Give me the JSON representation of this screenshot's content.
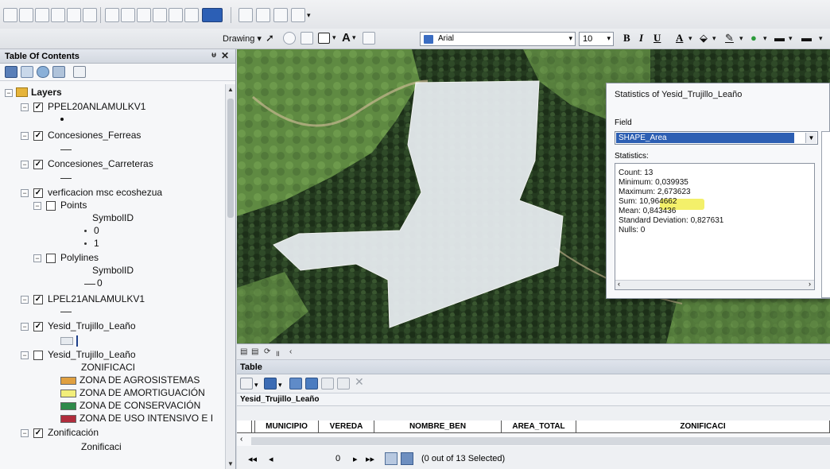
{
  "toolbar": {
    "drawing_label": "Drawing",
    "font_name": "Arial",
    "font_size": "10",
    "bold": "B",
    "italic": "I",
    "underline": "U",
    "font_color": "A"
  },
  "toc": {
    "title": "Table Of Contents",
    "pin": "ᵾ",
    "close": "✕",
    "root_label": "Layers",
    "layers": [
      {
        "label": "PPEL20ANLAMULKV1",
        "checked": true
      },
      {
        "label": "Concesiones_Ferreas",
        "checked": true
      },
      {
        "label": "Concesiones_Carreteras",
        "checked": true
      },
      {
        "label": "verficacion msc ecoshezua",
        "checked": true
      },
      {
        "label": "Points",
        "checked": false
      },
      {
        "label": "SymbolID",
        "checked": null
      },
      {
        "label": "0",
        "checked": null
      },
      {
        "label": "1",
        "checked": null
      },
      {
        "label": "Polylines",
        "checked": false
      },
      {
        "label": "SymbolID",
        "checked": null
      },
      {
        "label": "0",
        "checked": null
      },
      {
        "label": "LPEL21ANLAMULKV1",
        "checked": true
      },
      {
        "label": "Yesid_Trujillo_Leaño",
        "checked": true
      },
      {
        "label": "Yesid_Trujillo_Leaño",
        "checked": false
      },
      {
        "label": "ZONIFICACI",
        "checked": null
      },
      {
        "label": "Zonificación",
        "checked": true
      },
      {
        "label": "Zonificaci",
        "checked": null
      }
    ],
    "legend": [
      {
        "label": "ZONA DE AGROSISTEMAS",
        "color": "#e0a040"
      },
      {
        "label": "ZONA DE AMORTIGUACIÓN",
        "color": "#f2ee7a"
      },
      {
        "label": "ZONA DE CONSERVACIÓN",
        "color": "#2e8a4a"
      },
      {
        "label": "ZONA DE USO INTENSIVO E I",
        "color": "#b02c3c"
      }
    ]
  },
  "stats": {
    "title": "Statistics of Yesid_Trujillo_Leaño",
    "field_label": "Field",
    "field_value": "SHAPE_Area",
    "statistics_label": "Statistics:",
    "lines": [
      "Count:    13",
      "Minimum:  0,039935",
      "Maximum:  2,673623",
      "Sum:         10,964662",
      "Mean:       0,843436",
      "Standard Deviation: 0,827631",
      "Nulls:      0"
    ]
  },
  "table": {
    "title": "Table",
    "layer_name": "Yesid_Trujillo_Leaño",
    "columns": [
      "MUNICIPIO",
      "VEREDA",
      "NOMBRE_BEN",
      "AREA_TOTAL",
      "ZONIFICACI"
    ],
    "record_position": "0",
    "selection_status": "(0 out of 13 Selected)"
  }
}
